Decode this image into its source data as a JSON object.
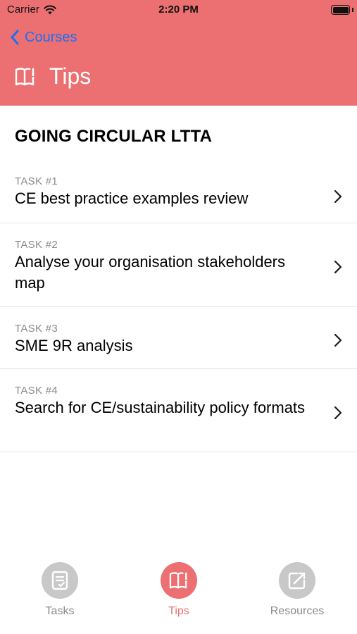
{
  "status_bar": {
    "carrier": "Carrier",
    "time": "2:20 PM",
    "wifi_icon": "wifi-icon",
    "battery_icon": "battery-icon"
  },
  "nav": {
    "back_label": "Courses",
    "back_icon": "chevron-left-icon",
    "title": "Tips",
    "title_icon": "book-exclamation-icon",
    "background_color": "#ec7072",
    "back_color": "#1e6ff5"
  },
  "section_title": "GOING CIRCULAR LTTA",
  "tasks": [
    {
      "number": "TASK #1",
      "title": "CE best practice examples review"
    },
    {
      "number": "TASK #2",
      "title": "Analyse your organisation stakeholders map"
    },
    {
      "number": "TASK #3",
      "title": "SME 9R analysis"
    },
    {
      "number": "TASK #4",
      "title": "Search for CE/sustainability policy formats"
    }
  ],
  "tab_bar": {
    "tabs": [
      {
        "label": "Tasks",
        "icon": "checklist-icon",
        "active": false
      },
      {
        "label": "Tips",
        "icon": "book-exclamation-icon",
        "active": true
      },
      {
        "label": "Resources",
        "icon": "external-edit-icon",
        "active": false
      }
    ],
    "active_color": "#ec7072",
    "inactive_color": "#c8c8c8"
  }
}
